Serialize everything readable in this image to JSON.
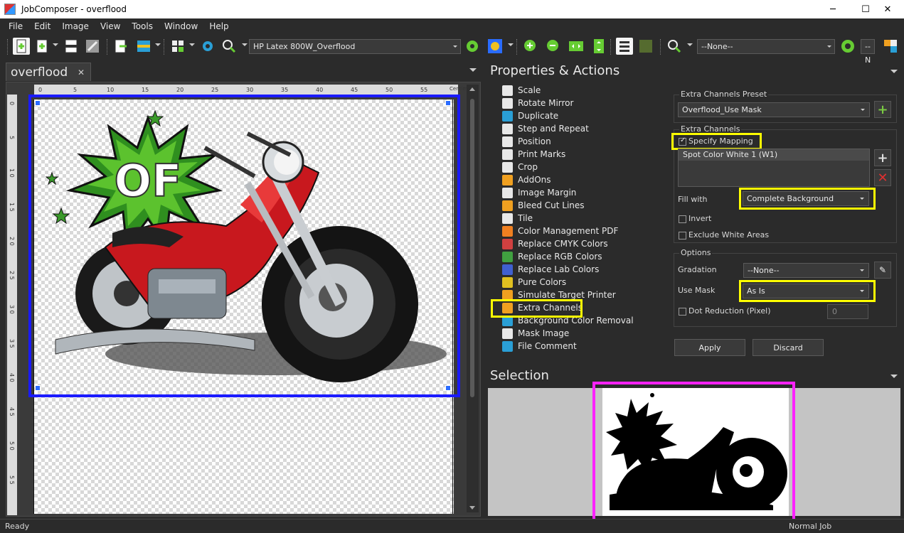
{
  "window": {
    "title": "JobComposer - overflood",
    "minimize": "─",
    "maximize": "☐",
    "close": "✕"
  },
  "menu": [
    "File",
    "Edit",
    "Image",
    "View",
    "Tools",
    "Window",
    "Help"
  ],
  "toolbar": {
    "printer_combo": "HP Latex 800W_Overflood",
    "layout_combo": "--None--",
    "trailing_combo": "--N"
  },
  "document": {
    "tab_label": "overflood",
    "tab_close": "✕",
    "units": "Centimeter",
    "ruler_top": [
      "0",
      "5",
      "10",
      "15",
      "20",
      "25",
      "30",
      "35",
      "40",
      "45",
      "50",
      "55"
    ],
    "ruler_left": [
      "0",
      "5",
      "1 0",
      "1 5",
      "2 0",
      "2 5",
      "3 0",
      "3 5",
      "4 0",
      "4 5",
      "5 0",
      "5 5"
    ],
    "badge_text": "OF"
  },
  "properties": {
    "header": "Properties & Actions",
    "actions": [
      {
        "label": "Scale",
        "icon": "scale-icon",
        "color": "#e8e8e8"
      },
      {
        "label": "Rotate Mirror",
        "icon": "rotate-icon",
        "color": "#e8e8e8"
      },
      {
        "label": "Duplicate",
        "icon": "duplicate-icon",
        "color": "#2a9fd6"
      },
      {
        "label": "Step and Repeat",
        "icon": "step-repeat-icon",
        "color": "#e8e8e8"
      },
      {
        "label": "Position",
        "icon": "position-icon",
        "color": "#e8e8e8"
      },
      {
        "label": "Print Marks",
        "icon": "print-marks-icon",
        "color": "#e8e8e8"
      },
      {
        "label": "Crop",
        "icon": "crop-icon",
        "color": "#e8e8e8"
      },
      {
        "label": "AddOns",
        "icon": "addons-icon",
        "color": "#f0a020"
      },
      {
        "label": "Image Margin",
        "icon": "image-margin-icon",
        "color": "#e8e8e8"
      },
      {
        "label": "Bleed Cut Lines",
        "icon": "bleed-icon",
        "color": "#f0a020"
      },
      {
        "label": "Tile",
        "icon": "tile-icon",
        "color": "#e8e8e8"
      },
      {
        "label": "Color Management PDF",
        "icon": "color-management-icon",
        "color": "#f08020"
      },
      {
        "label": "Replace CMYK Colors",
        "icon": "replace-cmyk-icon",
        "color": "#d04040"
      },
      {
        "label": "Replace RGB Colors",
        "icon": "replace-rgb-icon",
        "color": "#40a040"
      },
      {
        "label": "Replace Lab Colors",
        "icon": "replace-lab-icon",
        "color": "#4060d0"
      },
      {
        "label": "Pure Colors",
        "icon": "pure-colors-icon",
        "color": "#e0c020"
      },
      {
        "label": "Simulate Target Printer",
        "icon": "simulate-printer-icon",
        "color": "#f0a020"
      },
      {
        "label": "Extra Channels",
        "icon": "extra-channels-icon",
        "color": "#f0a020"
      },
      {
        "label": "Background Color Removal",
        "icon": "bg-removal-icon",
        "color": "#2a9fd6"
      },
      {
        "label": "Mask Image",
        "icon": "mask-image-icon",
        "color": "#e8e8e8"
      },
      {
        "label": "File Comment",
        "icon": "file-comment-icon",
        "color": "#2a9fd6"
      }
    ],
    "preset_group": "Extra Channels Preset",
    "preset_value": "Overflood_Use Mask",
    "channels_group": "Extra Channels",
    "specify_mapping": "Specify Mapping",
    "channel_item": "Spot Color White 1 (W1)",
    "fill_with_label": "Fill with",
    "fill_with_value": "Complete Background",
    "invert_label": "Invert",
    "exclude_white_label": "Exclude White Areas",
    "options_group": "Options",
    "gradation_label": "Gradation",
    "gradation_value": "--None--",
    "use_mask_label": "Use Mask",
    "use_mask_value": "As Is",
    "dot_reduction_label": "Dot Reduction (Pixel)",
    "dot_reduction_value": "0",
    "apply": "Apply",
    "discard": "Discard"
  },
  "selection": {
    "header": "Selection"
  },
  "status": {
    "left": "Ready",
    "right": "Normal Job"
  },
  "colors": {
    "highlight_yellow": "#ffff00",
    "highlight_magenta": "#ff22ff",
    "selection_blue": "#1a1aff",
    "add_green": "#7ac943",
    "remove_red": "#e03030"
  }
}
